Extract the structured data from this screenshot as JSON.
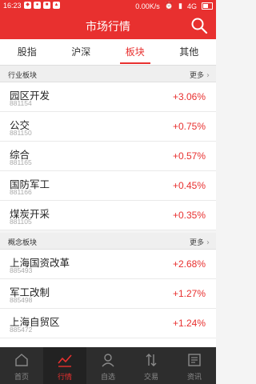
{
  "status": {
    "time": "16:23",
    "network_speed": "0.00K/s",
    "network_type": "4G"
  },
  "header": {
    "title": "市场行情"
  },
  "tabs": [
    {
      "label": "股指",
      "active": false
    },
    {
      "label": "沪深",
      "active": false
    },
    {
      "label": "板块",
      "active": true
    },
    {
      "label": "其他",
      "active": false
    }
  ],
  "sections": [
    {
      "title": "行业板块",
      "more_label": "更多",
      "items": [
        {
          "name": "园区开发",
          "code": "881154",
          "change": "+3.06%"
        },
        {
          "name": "公交",
          "code": "881150",
          "change": "+0.75%"
        },
        {
          "name": "综合",
          "code": "881165",
          "change": "+0.57%"
        },
        {
          "name": "国防军工",
          "code": "881166",
          "change": "+0.45%"
        },
        {
          "name": "煤炭开采",
          "code": "881105",
          "change": "+0.35%"
        }
      ]
    },
    {
      "title": "概念板块",
      "more_label": "更多",
      "items": [
        {
          "name": "上海国资改革",
          "code": "885493",
          "change": "+2.68%"
        },
        {
          "name": "军工改制",
          "code": "885498",
          "change": "+1.27%"
        },
        {
          "name": "上海自贸区",
          "code": "885472",
          "change": "+1.24%"
        }
      ]
    }
  ],
  "bottom_nav": [
    {
      "label": "首页",
      "icon": "home-icon",
      "active": false
    },
    {
      "label": "行情",
      "icon": "chart-icon",
      "active": true
    },
    {
      "label": "自选",
      "icon": "person-icon",
      "active": false
    },
    {
      "label": "交易",
      "icon": "transfer-icon",
      "active": false
    },
    {
      "label": "资讯",
      "icon": "news-icon",
      "active": false
    }
  ],
  "colors": {
    "accent": "#e8302f",
    "nav_background": "#2d2d2d"
  }
}
